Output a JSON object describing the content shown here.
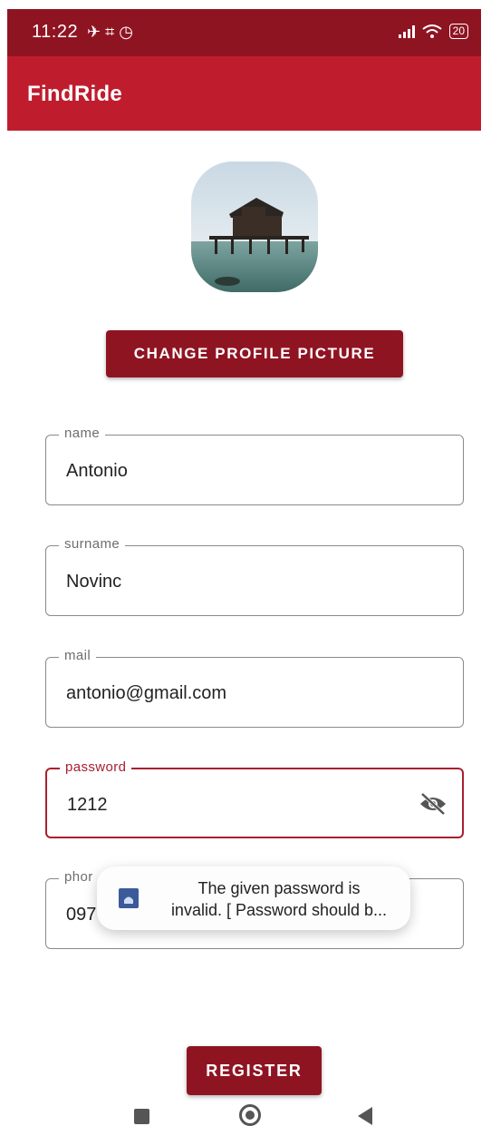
{
  "status_bar": {
    "time": "11:22",
    "notification_icons": "✈ ⌗ ◷",
    "battery": "20"
  },
  "app_bar": {
    "title": "FindRide"
  },
  "profile": {
    "change_picture_label": "CHANGE PROFILE PICTURE"
  },
  "form": {
    "name": {
      "label": "name",
      "value": "Antonio"
    },
    "surname": {
      "label": "surname",
      "value": "Novinc"
    },
    "mail": {
      "label": "mail",
      "value": "antonio@gmail.com"
    },
    "password": {
      "label": "password",
      "value": "1212"
    },
    "phone": {
      "label": "phor",
      "value": "097"
    }
  },
  "toast": {
    "line1": "The given password is",
    "line2": "invalid. [ Password should b..."
  },
  "register_label": "REGISTER",
  "colors": {
    "status_bar": "#8f1422",
    "app_bar": "#bf1d2e",
    "button": "#8f1422",
    "focus": "#a8202f"
  },
  "icons": [
    "signal-icon",
    "wifi-icon",
    "battery-icon",
    "eye-off-icon",
    "android-icon",
    "nav-recents-icon",
    "nav-home-icon",
    "nav-back-icon"
  ]
}
